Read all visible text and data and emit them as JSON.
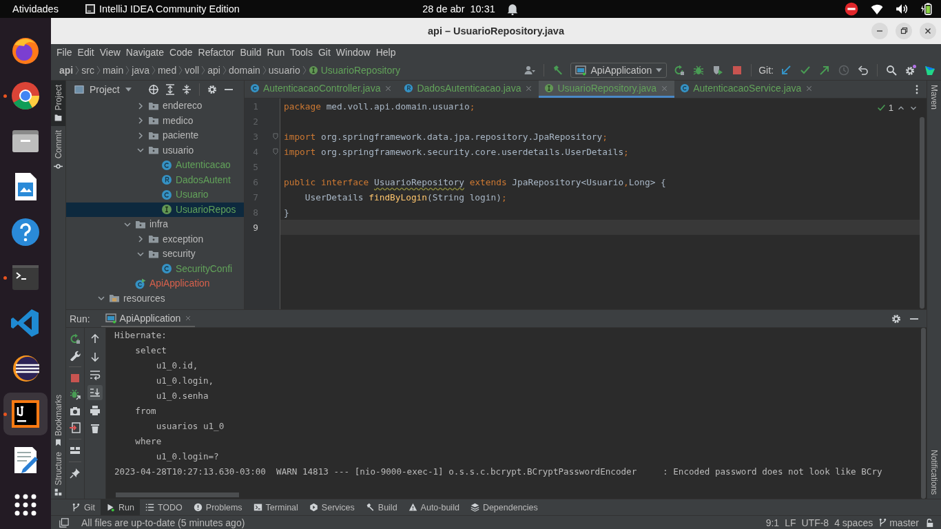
{
  "topbar": {
    "activities": "Atividades",
    "app": "IntelliJ IDEA Community Edition",
    "date": "28 de abr",
    "time": "10:31"
  },
  "dock": [
    {
      "kind": "firefox",
      "running": false,
      "selected": false
    },
    {
      "kind": "chrome",
      "running": true,
      "selected": false
    },
    {
      "kind": "files",
      "running": false,
      "selected": false
    },
    {
      "kind": "writer",
      "running": false,
      "selected": false
    },
    {
      "kind": "help",
      "running": false,
      "selected": false
    },
    {
      "kind": "terminal",
      "running": true,
      "selected": false
    },
    {
      "kind": "vscode",
      "running": false,
      "selected": false
    },
    {
      "kind": "eclipse",
      "running": false,
      "selected": false
    },
    {
      "kind": "intellij",
      "running": true,
      "selected": true
    },
    {
      "kind": "editor",
      "running": false,
      "selected": false
    },
    {
      "kind": "apps",
      "running": false,
      "selected": false
    }
  ],
  "window": {
    "title": "api – UsuarioRepository.java"
  },
  "menu": [
    "File",
    "Edit",
    "View",
    "Navigate",
    "Code",
    "Refactor",
    "Build",
    "Run",
    "Tools",
    "Git",
    "Window",
    "Help"
  ],
  "breadcrumb": [
    {
      "label": "api",
      "kind": "module"
    },
    {
      "label": "src",
      "kind": "dir"
    },
    {
      "label": "main",
      "kind": "dir"
    },
    {
      "label": "java",
      "kind": "dir"
    },
    {
      "label": "med",
      "kind": "dir"
    },
    {
      "label": "voll",
      "kind": "dir"
    },
    {
      "label": "api",
      "kind": "dir"
    },
    {
      "label": "domain",
      "kind": "dir"
    },
    {
      "label": "usuario",
      "kind": "dir"
    },
    {
      "label": "UsuarioRepository",
      "kind": "interface",
      "color": "#62a35a"
    }
  ],
  "toolbar": {
    "run_config": "ApiApplication",
    "git_label": "Git:"
  },
  "left_stripe": [
    {
      "label": "Project",
      "selected": true
    },
    {
      "label": "Commit",
      "selected": false
    }
  ],
  "left_stripe_bottom": [
    "Bookmarks",
    "Structure"
  ],
  "right_stripe": {
    "top": "Maven",
    "bottom": "Notifications"
  },
  "project": {
    "title": "Project",
    "tree": [
      {
        "children": [
          {
            "children": [
              {
                "children": [
                  {
                    "label": "endereco",
                    "kind": "folder",
                    "expanded": false,
                    "selected": false
                  },
                  {
                    "label": "medico",
                    "kind": "folder",
                    "expanded": false,
                    "selected": false
                  },
                  {
                    "label": "paciente",
                    "kind": "folder",
                    "expanded": false,
                    "selected": false
                  },
                  {
                    "label": "usuario",
                    "kind": "folder",
                    "expanded": true,
                    "selected": false,
                    "children": [
                      {
                        "label": "Autenticacao",
                        "kind": "class",
                        "color": "#62a35a",
                        "selected": false
                      },
                      {
                        "label": "DadosAutent",
                        "kind": "record",
                        "color": "#62a35a",
                        "selected": false
                      },
                      {
                        "label": "Usuario",
                        "kind": "class",
                        "color": "#62a35a",
                        "selected": false
                      },
                      {
                        "label": "UsuarioRepos",
                        "kind": "interface",
                        "color": "#62a35a",
                        "selected": true
                      }
                    ]
                  }
                ]
              },
              {
                "label": "infra",
                "kind": "folder",
                "expanded": true,
                "selected": false,
                "children": [
                  {
                    "label": "exception",
                    "kind": "folder",
                    "expanded": false,
                    "selected": false
                  },
                  {
                    "label": "security",
                    "kind": "folder",
                    "expanded": true,
                    "selected": false,
                    "children": [
                      {
                        "label": "SecurityConfi",
                        "kind": "class",
                        "color": "#62a35a",
                        "selected": false
                      }
                    ]
                  }
                ]
              },
              {
                "label": "ApiApplication",
                "kind": "app",
                "color": "#d9614c",
                "selected": false
              }
            ]
          }
        ]
      },
      {
        "label": "resources",
        "kind": "resources",
        "expanded": true,
        "selected": false
      }
    ]
  },
  "tabs": [
    {
      "label": "AutenticacaoController.java",
      "kind": "class",
      "color": "#62a35a",
      "selected": false
    },
    {
      "label": "DadosAutenticacao.java",
      "kind": "record",
      "color": "#62a35a",
      "selected": false
    },
    {
      "label": "UsuarioRepository.java",
      "kind": "interface",
      "color": "#62a35a",
      "selected": true
    },
    {
      "label": "AutenticacaoService.java",
      "kind": "class",
      "color": "#62a35a",
      "selected": false
    }
  ],
  "editor": {
    "inspections": "1",
    "lines": [
      {
        "num": "1",
        "current": false,
        "tokens": [
          {
            "t": "package",
            "kind": "keyword"
          },
          {
            "t": " med.voll.api.domain.usuario",
            "kind": "plain"
          },
          {
            "t": ";",
            "kind": "keyword"
          }
        ]
      },
      {
        "num": "2",
        "current": false
      },
      {
        "num": "3",
        "current": false,
        "fold": true,
        "tokens": [
          {
            "t": "import",
            "kind": "keyword"
          },
          {
            "t": " org.springframework.data.jpa.repository.JpaRepository",
            "kind": "plain"
          },
          {
            "t": ";",
            "kind": "keyword"
          }
        ]
      },
      {
        "num": "4",
        "current": false,
        "fold": true,
        "tokens": [
          {
            "t": "import",
            "kind": "keyword"
          },
          {
            "t": " org.springframework.security.core.userdetails.UserDetails",
            "kind": "plain"
          },
          {
            "t": ";",
            "kind": "keyword"
          }
        ]
      },
      {
        "num": "5",
        "current": false
      },
      {
        "num": "6",
        "current": false,
        "tokens": [
          {
            "t": "public interface ",
            "kind": "keyword"
          },
          {
            "t": "UsuarioRepository",
            "kind": "warning"
          },
          {
            "t": " extends ",
            "kind": "keyword"
          },
          {
            "t": "JpaRepository<Usuario",
            "kind": "plain"
          },
          {
            "t": ",",
            "kind": "keyword"
          },
          {
            "t": "Long> {",
            "kind": "plain"
          }
        ]
      },
      {
        "num": "7",
        "current": false,
        "tokens": [
          {
            "t": "    UserDetails ",
            "kind": "plain"
          },
          {
            "t": "findByLogin",
            "kind": "method"
          },
          {
            "t": "(String login)",
            "kind": "plain"
          },
          {
            "t": ";",
            "kind": "keyword"
          }
        ]
      },
      {
        "num": "8",
        "current": false,
        "tokens": [
          {
            "t": "}",
            "kind": "plain"
          }
        ]
      },
      {
        "num": "9",
        "current": true
      }
    ]
  },
  "run": {
    "label": "Run:",
    "tab": "ApiApplication",
    "console": [
      "Hibernate:",
      "    select",
      "        u1_0.id,",
      "        u1_0.login,",
      "        u1_0.senha",
      "    from",
      "        usuarios u1_0",
      "    where",
      "        u1_0.login=?",
      "2023-04-28T10:27:13.630-03:00  WARN 14813 --- [nio-9000-exec-1] o.s.s.c.bcrypt.BCryptPasswordEncoder     : Encoded password does not look like BCry"
    ]
  },
  "tool_windows": [
    {
      "label": "Git",
      "kind": "git",
      "selected": false
    },
    {
      "label": "Run",
      "kind": "run",
      "selected": true
    },
    {
      "label": "TODO",
      "kind": "todo",
      "selected": false
    },
    {
      "label": "Problems",
      "kind": "problems",
      "selected": false
    },
    {
      "label": "Terminal",
      "kind": "terminal",
      "selected": false
    },
    {
      "label": "Services",
      "kind": "services",
      "selected": false
    },
    {
      "label": "Build",
      "kind": "build",
      "selected": false
    },
    {
      "label": "Auto-build",
      "kind": "autobuild",
      "selected": false
    },
    {
      "label": "Dependencies",
      "kind": "deps",
      "selected": false
    }
  ],
  "status": {
    "message": "All files are up-to-date (5 minutes ago)",
    "position": "9:1",
    "line_sep": "LF",
    "encoding": "UTF-8",
    "indent": "4 spaces",
    "branch": "master"
  }
}
